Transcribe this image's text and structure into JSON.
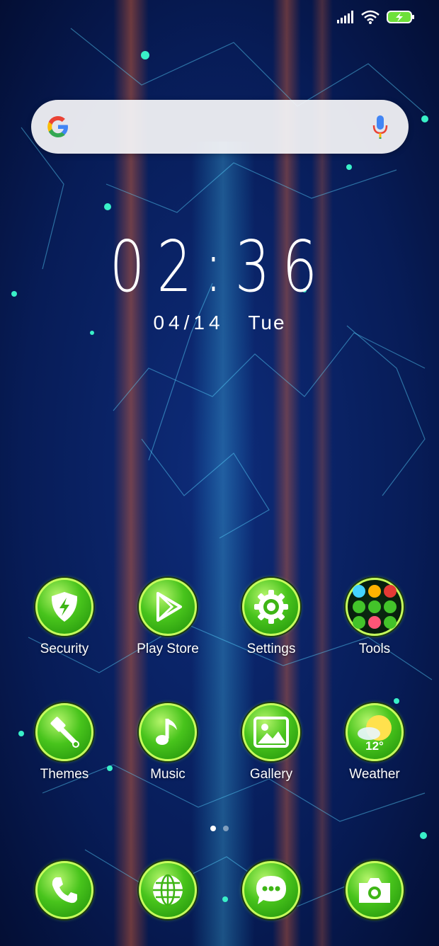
{
  "status": {
    "signal_icon": "signal-icon",
    "wifi_icon": "wifi-icon",
    "battery_icon": "battery-charging-icon"
  },
  "search": {
    "logo": "google-g-logo",
    "mic_icon": "mic-icon"
  },
  "clock": {
    "time": "02:36",
    "date": "04/14",
    "weekday": "Tue"
  },
  "apps_row1": [
    {
      "label": "Security",
      "icon": "shield-icon"
    },
    {
      "label": "Play Store",
      "icon": "play-icon"
    },
    {
      "label": "Settings",
      "icon": "gear-icon"
    },
    {
      "label": "Tools",
      "icon": "folder-icon"
    }
  ],
  "apps_row2": [
    {
      "label": "Themes",
      "icon": "brush-icon"
    },
    {
      "label": "Music",
      "icon": "music-note-icon"
    },
    {
      "label": "Gallery",
      "icon": "image-icon"
    },
    {
      "label": "Weather",
      "icon": "weather-sun-icon",
      "temp": "12°"
    }
  ],
  "dock": [
    {
      "icon": "phone-icon"
    },
    {
      "icon": "globe-icon"
    },
    {
      "icon": "chat-icon"
    },
    {
      "icon": "camera-icon"
    }
  ],
  "pages": {
    "count": 2,
    "active": 1
  },
  "colors": {
    "icon_green": "#48c41c",
    "ring": "#c6ff5c",
    "wallpaper": "#061a52"
  }
}
